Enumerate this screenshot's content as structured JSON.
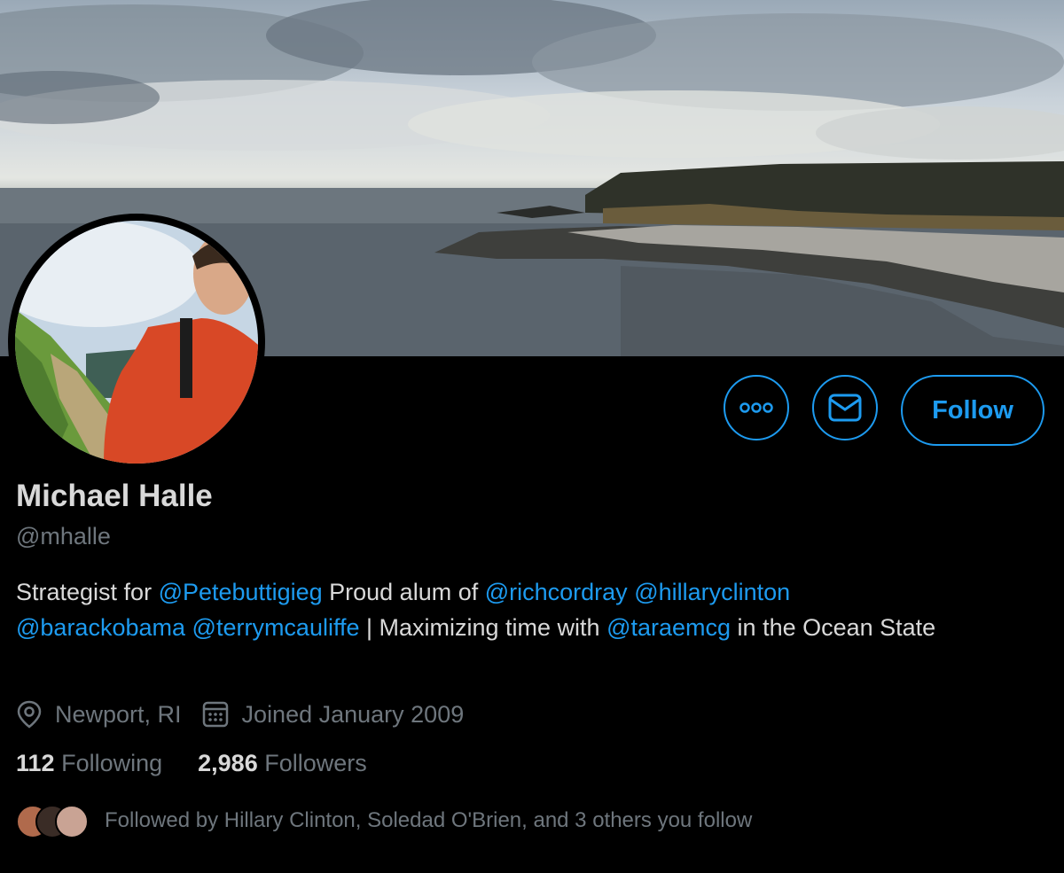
{
  "profile": {
    "name": "Michael Halle",
    "handle": "@mhalle",
    "bio": {
      "t1": "Strategist for ",
      "m1": "@Petebuttigieg",
      "t2": " Proud alum of ",
      "m2": "@richcordray",
      "t3": " ",
      "m3": "@hillaryclinton",
      "t4": " ",
      "m4": "@barackobama",
      "t5": " ",
      "m5": "@terrymcauliffe",
      "t6": " | Maximizing time with ",
      "m6": "@taraemcg",
      "t7": " in the Ocean State"
    },
    "location": "Newport, RI",
    "joined": "Joined January 2009",
    "following_count": "112",
    "following_label": "Following",
    "followers_count": "2,986",
    "followers_label": "Followers",
    "followed_by": "Followed by Hillary Clinton, Soledad O'Brien, and 3 others you follow"
  },
  "actions": {
    "follow_label": "Follow"
  },
  "icons": {
    "more": "more-icon",
    "message": "envelope-icon",
    "location": "location-pin-icon",
    "calendar": "calendar-icon"
  },
  "colors": {
    "accent": "#1d9bf0",
    "background": "#000000",
    "secondary_text": "#6e767d",
    "primary_text": "#d9d9d9"
  }
}
